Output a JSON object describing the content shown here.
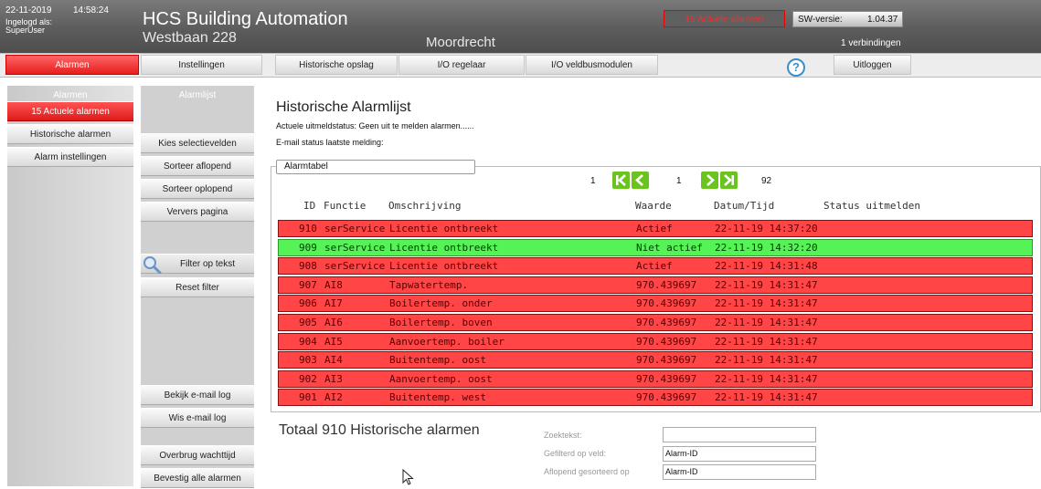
{
  "header": {
    "date": "22-11-2019",
    "time": "14:58:24",
    "login_label": "Ingelogd als:",
    "login_user": "SuperUser",
    "title": "HCS Building Automation",
    "site": "Westbaan 228",
    "city": "Moordrecht",
    "alarm_badge": "15 Actuele alarmen",
    "sw_label": "SW-versie:",
    "sw_version": "1.04.37",
    "connections": "1 verbindingen"
  },
  "nav": [
    "Alarmen",
    "Instellingen",
    "Historische opslag",
    "I/O regelaar",
    "I/O veldbusmodulen",
    "Uitloggen"
  ],
  "help_icon": "?",
  "sidebar1": {
    "heading": "Alarmen",
    "items": [
      "15 Actuele alarmen",
      "Historische alarmen",
      "Alarm instellingen"
    ]
  },
  "sidebar2": {
    "heading": "Alarmlijst",
    "items": [
      "Kies selectievelden",
      "Sorteer aflopend",
      "Sorteer oplopend",
      "Ververs pagina",
      "Filter op tekst",
      "Reset filter",
      "Bekijk e-mail log",
      "Wis e-mail log",
      "Overbrug wachttijd",
      "Bevestig alle alarmen"
    ]
  },
  "main": {
    "title": "Historische Alarmlijst",
    "status1": "Actuele uitmeldstatus: Geen uit te melden alarmen......",
    "status2": "E-mail status laatste melding:",
    "legend": "Alarmtabel"
  },
  "pager": {
    "first": "1",
    "current": "1",
    "total": "92"
  },
  "table": {
    "headers": [
      "ID",
      "Functie",
      "Omschrijving",
      "Waarde",
      "Datum/Tijd",
      "Status uitmelden"
    ],
    "rows": [
      {
        "id": "910",
        "functie": "serService",
        "omschrijving": "Licentie ontbreekt",
        "waarde": "Actief",
        "datum": "22-11-19 14:37:20",
        "color": "red"
      },
      {
        "id": "909",
        "functie": "serService",
        "omschrijving": "Licentie ontbreekt",
        "waarde": "Niet actief",
        "datum": "22-11-19 14:32:20",
        "color": "green"
      },
      {
        "id": "908",
        "functie": "serService",
        "omschrijving": "Licentie ontbreekt",
        "waarde": "Actief",
        "datum": "22-11-19 14:31:48",
        "color": "red"
      },
      {
        "id": "907",
        "functie": "AI8",
        "omschrijving": "Tapwatertemp.",
        "waarde": "970.439697",
        "datum": "22-11-19 14:31:47",
        "color": "red"
      },
      {
        "id": "906",
        "functie": "AI7",
        "omschrijving": "Boilertemp. onder",
        "waarde": "970.439697",
        "datum": "22-11-19 14:31:47",
        "color": "red"
      },
      {
        "id": "905",
        "functie": "AI6",
        "omschrijving": "Boilertemp. boven",
        "waarde": "970.439697",
        "datum": "22-11-19 14:31:47",
        "color": "red"
      },
      {
        "id": "904",
        "functie": "AI5",
        "omschrijving": "Aanvoertemp. boiler",
        "waarde": "970.439697",
        "datum": "22-11-19 14:31:47",
        "color": "red"
      },
      {
        "id": "903",
        "functie": "AI4",
        "omschrijving": "Buitentemp. oost",
        "waarde": "970.439697",
        "datum": "22-11-19 14:31:47",
        "color": "red"
      },
      {
        "id": "902",
        "functie": "AI3",
        "omschrijving": "Aanvoertemp. oost",
        "waarde": "970.439697",
        "datum": "22-11-19 14:31:47",
        "color": "red"
      },
      {
        "id": "901",
        "functie": "AI2",
        "omschrijving": "Buitentemp. west",
        "waarde": "970.439697",
        "datum": "22-11-19 14:31:47",
        "color": "red"
      }
    ]
  },
  "footer": {
    "totaal": "Totaal 910 Historische alarmen",
    "search_label": "Zoektekst:",
    "search_value": "",
    "filter_label": "Gefilterd op veld:",
    "filter_value": "Alarm-ID",
    "sort_label": "Aflopend gesorteerd op",
    "sort_value": "Alarm-ID"
  },
  "colors": {
    "alarm_red": "#ff4545",
    "ok_green": "#56f356",
    "nav_active": "#e61e1e",
    "pager_green": "#6bc41e"
  },
  "icons": [
    "help-icon",
    "search-icon",
    "first-page-icon",
    "prev-page-icon",
    "next-page-icon",
    "last-page-icon",
    "mouse-cursor-icon"
  ]
}
